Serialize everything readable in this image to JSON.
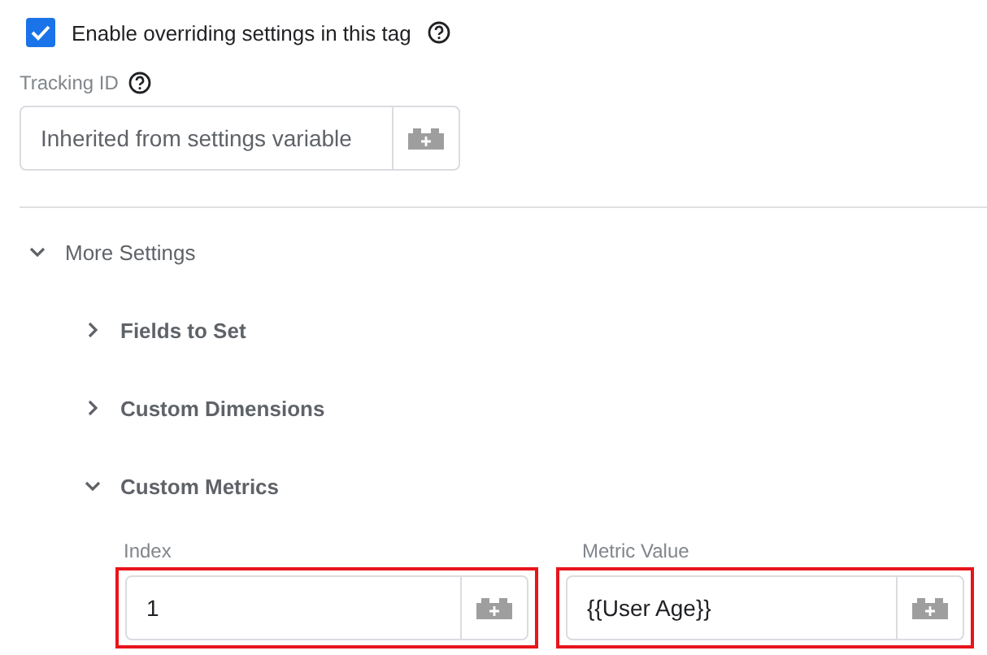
{
  "override": {
    "label": "Enable overriding settings in this tag",
    "checked": true
  },
  "tracking_id": {
    "label": "Tracking ID",
    "placeholder": "Inherited from settings variable"
  },
  "more_settings": {
    "label": "More Settings",
    "expanded": true,
    "sections": [
      {
        "label": "Fields to Set",
        "expanded": false
      },
      {
        "label": "Custom Dimensions",
        "expanded": false
      },
      {
        "label": "Custom Metrics",
        "expanded": true,
        "columns": [
          "Index",
          "Metric Value"
        ],
        "rows": [
          {
            "index": "1",
            "value": "{{User Age}}",
            "highlighted": true
          }
        ]
      }
    ]
  }
}
